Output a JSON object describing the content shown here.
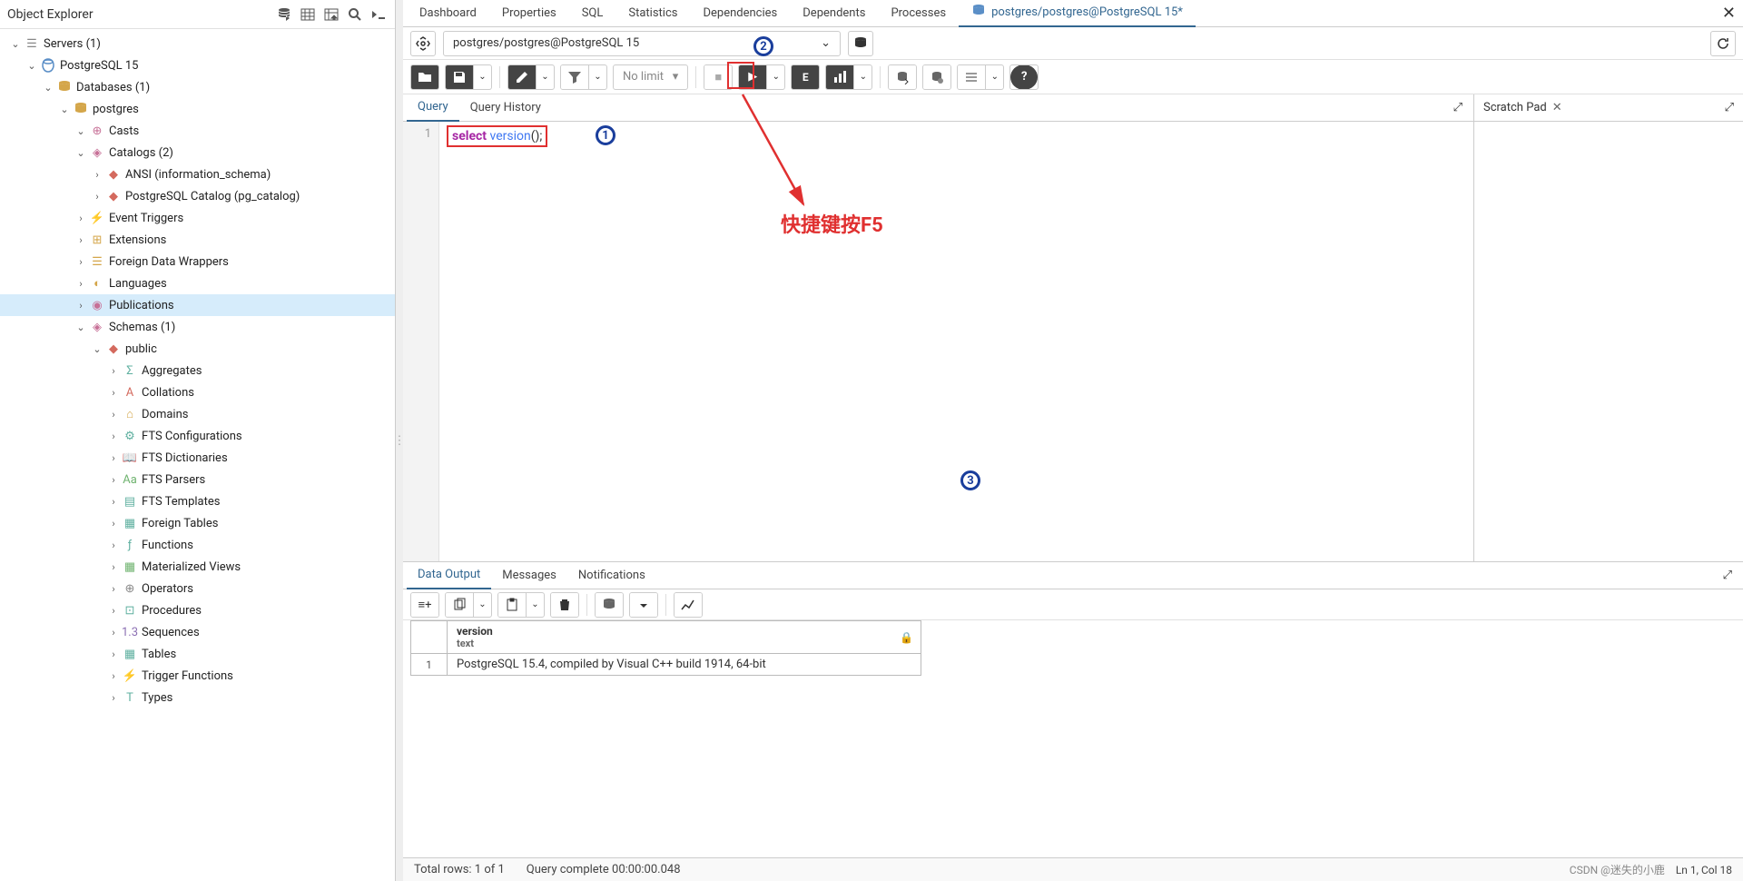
{
  "explorer": {
    "title": "Object Explorer",
    "tree": {
      "servers": "Servers (1)",
      "pg15": "PostgreSQL 15",
      "databases": "Databases (1)",
      "postgres": "postgres",
      "casts": "Casts",
      "catalogs": "Catalogs (2)",
      "ansi": "ANSI (information_schema)",
      "pgcatalog": "PostgreSQL Catalog (pg_catalog)",
      "eventtriggers": "Event Triggers",
      "extensions": "Extensions",
      "fdw": "Foreign Data Wrappers",
      "languages": "Languages",
      "publications": "Publications",
      "schemas": "Schemas (1)",
      "public": "public",
      "aggregates": "Aggregates",
      "collations": "Collations",
      "domains": "Domains",
      "ftsconf": "FTS Configurations",
      "ftsdict": "FTS Dictionaries",
      "ftsparsers": "FTS Parsers",
      "ftstmpl": "FTS Templates",
      "foreigntables": "Foreign Tables",
      "functions": "Functions",
      "matviews": "Materialized Views",
      "operators": "Operators",
      "procedures": "Procedures",
      "sequences": "Sequences",
      "tables": "Tables",
      "triggerfuncs": "Trigger Functions",
      "types": "Types"
    }
  },
  "tabs": {
    "dashboard": "Dashboard",
    "properties": "Properties",
    "sql": "SQL",
    "statistics": "Statistics",
    "dependencies": "Dependencies",
    "dependents": "Dependents",
    "processes": "Processes",
    "querytool": "postgres/postgres@PostgreSQL 15*"
  },
  "conn": {
    "label": "postgres/postgres@PostgreSQL 15"
  },
  "toolbar": {
    "nolimit": "No limit"
  },
  "editor": {
    "query_tab": "Query",
    "history_tab": "Query History",
    "line1_kw1": "select",
    "line1_kw2": "version",
    "line1_pn": "();"
  },
  "scratch": {
    "title": "Scratch Pad"
  },
  "results": {
    "dataoutput": "Data Output",
    "messages": "Messages",
    "notifications": "Notifications",
    "col_name": "version",
    "col_type": "text",
    "row1_num": "1",
    "row1_val": "PostgreSQL 15.4, compiled by Visual C++ build 1914, 64-bit"
  },
  "status": {
    "rows": "Total rows: 1 of 1",
    "complete": "Query complete 00:00:00.048",
    "pos": "Ln 1, Col 18"
  },
  "anno": {
    "c1": "1",
    "c2": "2",
    "c3": "3",
    "f5text": "快捷键按F5",
    "watermark": "CSDN @迷失的小鹿"
  }
}
